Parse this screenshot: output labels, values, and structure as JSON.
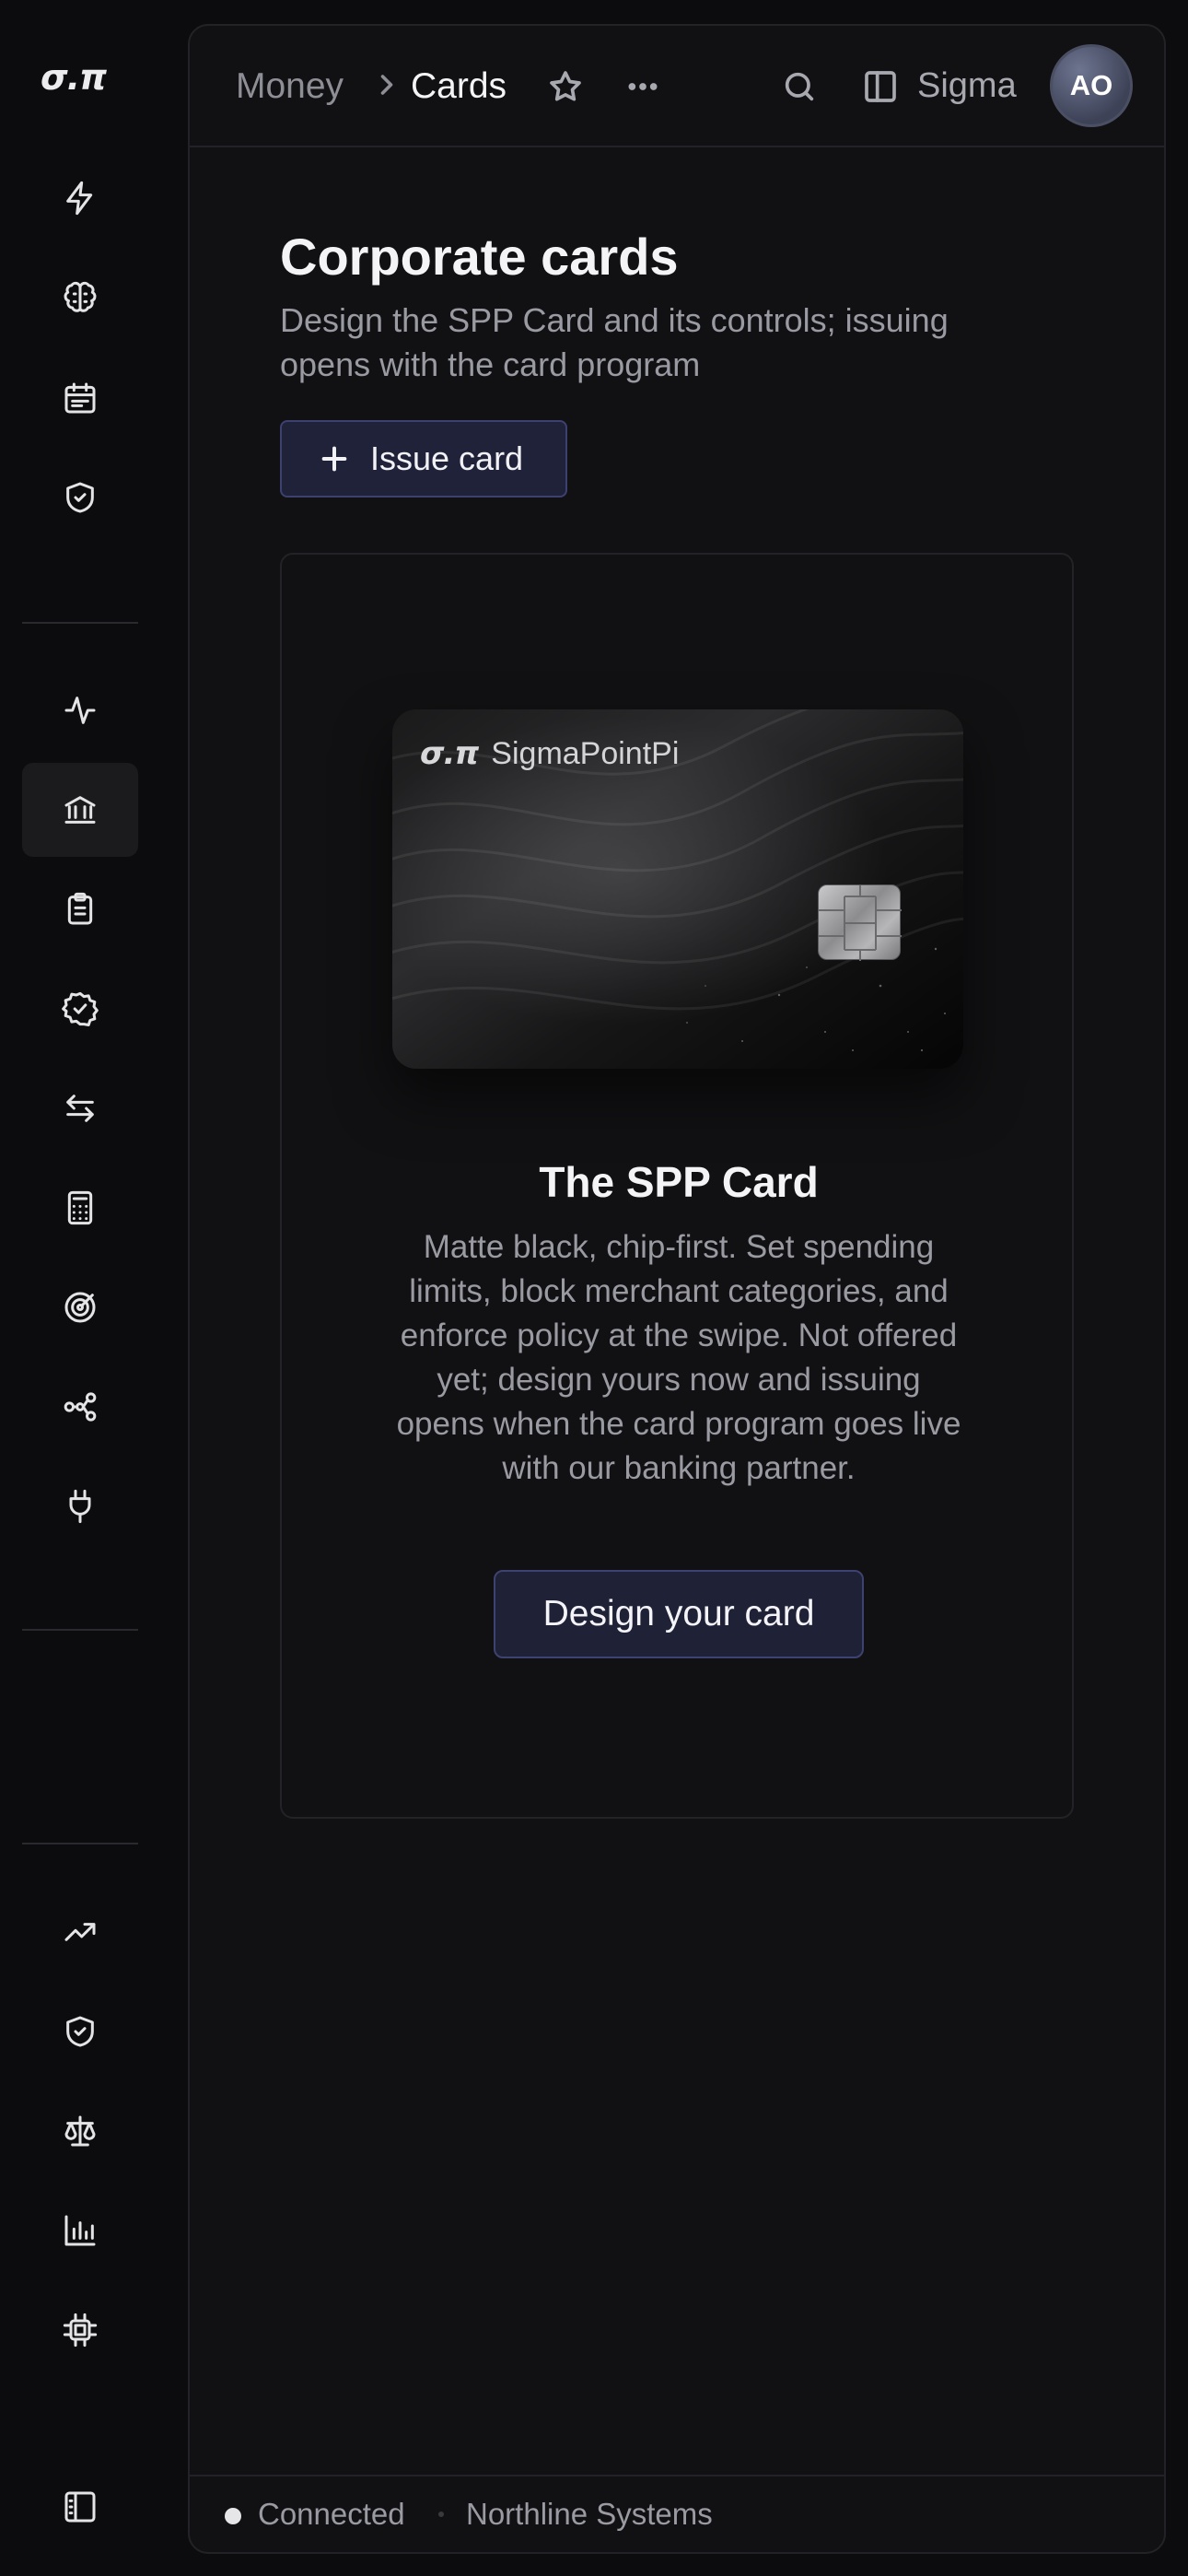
{
  "brand": {
    "logo_text": "σ.π"
  },
  "rail": {
    "items": [
      {
        "icon": "bolt-icon"
      },
      {
        "icon": "brain-icon"
      },
      {
        "icon": "calendar-list-icon"
      },
      {
        "icon": "shield-check-icon"
      },
      {
        "icon": "activity-icon"
      },
      {
        "icon": "bank-icon",
        "active": true
      },
      {
        "icon": "clipboard-icon"
      },
      {
        "icon": "badge-check-icon"
      },
      {
        "icon": "transfer-arrows-icon"
      },
      {
        "icon": "calculator-icon"
      },
      {
        "icon": "target-icon"
      },
      {
        "icon": "workflow-icon"
      },
      {
        "icon": "plug-icon"
      },
      {
        "icon": "trending-up-icon"
      },
      {
        "icon": "shield-check-icon"
      },
      {
        "icon": "scale-icon"
      },
      {
        "icon": "bar-chart-icon"
      },
      {
        "icon": "cpu-icon"
      },
      {
        "icon": "sidebar-toggle-icon"
      }
    ]
  },
  "topbar": {
    "breadcrumb_parent": "Money",
    "breadcrumb_current": "Cards",
    "workspace_label": "Sigma",
    "avatar_initials": "AO"
  },
  "page": {
    "title": "Corporate cards",
    "subtitle": "Design the SPP Card and its controls; issuing opens with the card program",
    "issue_button": "Issue card"
  },
  "card_panel": {
    "card_logo_mark": "σ.π",
    "card_brand_name": "SigmaPointPi",
    "product_title": "The SPP Card",
    "product_description": "Matte black, chip-first. Set spending limits, block merchant categories, and enforce policy at the swipe. Not offered yet; design yours now and issuing opens when the card program goes live with our banking partner.",
    "cta_label": "Design your card"
  },
  "status": {
    "connection": "Connected",
    "organization": "Northline Systems"
  }
}
